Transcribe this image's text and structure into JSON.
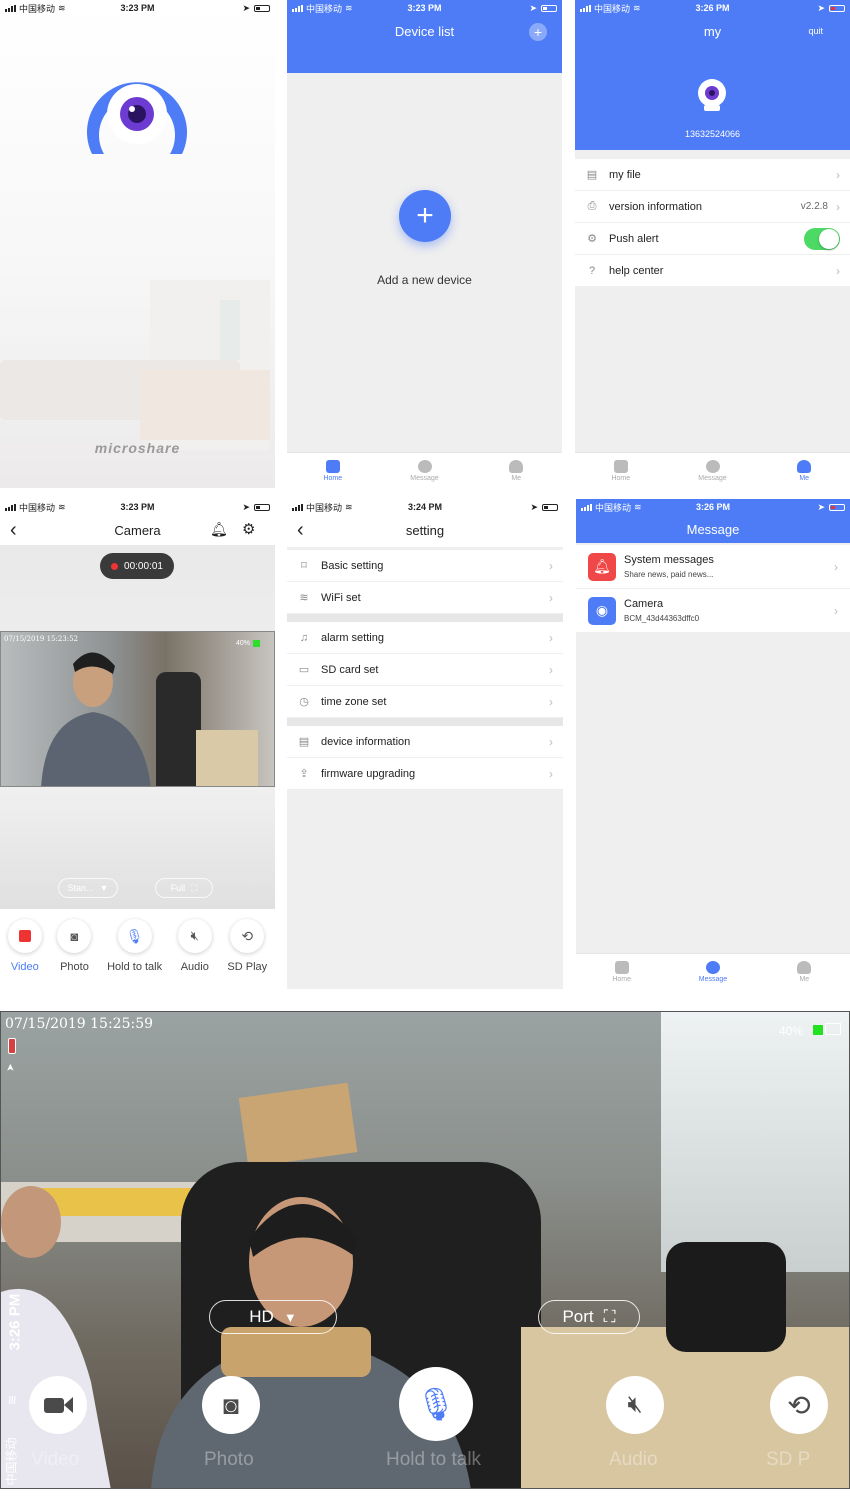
{
  "status": {
    "carrier": "中国移动",
    "times": [
      "3:23 PM",
      "3:23 PM",
      "3:26 PM",
      "3:23 PM",
      "3:24 PM",
      "3:26 PM",
      "3:26 PM"
    ]
  },
  "splash": {
    "brand": "microshare"
  },
  "device_list": {
    "title": "Device list",
    "add_label": "Add a new device"
  },
  "me": {
    "title": "my",
    "quit": "quit",
    "phone": "13632524066",
    "items": [
      {
        "label": "my file",
        "value": ""
      },
      {
        "label": "version information",
        "value": "v2.2.8"
      },
      {
        "label": "Push alert",
        "value": ""
      },
      {
        "label": "help center",
        "value": ""
      }
    ]
  },
  "tabs": {
    "home": "Home",
    "message": "Message",
    "me": "Me"
  },
  "camera": {
    "title": "Camera",
    "rec_time": "00:00:01",
    "timestamp": "07/15/2019 15:23:52",
    "battery": "40%",
    "quality": "Stan...",
    "full": "Full",
    "controls": [
      "Video",
      "Photo",
      "Hold to talk",
      "Audio",
      "SD Play"
    ]
  },
  "setting": {
    "title": "setting",
    "group1": [
      "Basic setting",
      "WiFi set"
    ],
    "group2": [
      "alarm setting",
      "SD card set",
      "time zone set"
    ],
    "group3": [
      "device information",
      "firmware upgrading"
    ]
  },
  "message": {
    "title": "Message",
    "items": [
      {
        "title": "System messages",
        "sub": "Share news, paid news..."
      },
      {
        "title": "Camera",
        "sub": "BCM_43d44363dffc0"
      }
    ]
  },
  "landscape": {
    "timestamp": "07/15/2019 15:25:59",
    "battery": "40%",
    "time": "3:26 PM",
    "hd": "HD",
    "port": "Port",
    "controls": [
      "Video",
      "Photo",
      "Hold to talk",
      "Audio",
      "SD P"
    ]
  },
  "colors": {
    "accent": "#4d7cf6",
    "record": "#e33333",
    "toggle": "#4cd964"
  }
}
